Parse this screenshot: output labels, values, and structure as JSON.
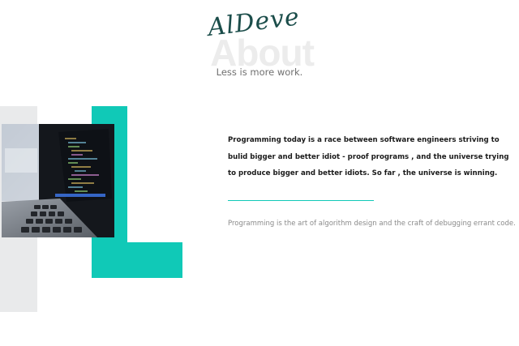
{
  "brand": {
    "logo_text": "AlDeve"
  },
  "section": {
    "watermark": "About",
    "tagline": "Less is more work."
  },
  "content": {
    "lead": "Programming today is a race between software engineers striving to bulid bigger and better idiot - proof programs , and the universe trying to produce bigger and better idiots. So far , the universe is winning.",
    "body": "Programming is the art of algorithm design and the craft of debugging errant code."
  },
  "colors": {
    "accent": "#10c9b7",
    "panel": "#e9eaeb",
    "logo": "#1b4d4a",
    "watermark": "#ececec"
  },
  "images": {
    "about_photo": "laptop-with-code-photo"
  }
}
